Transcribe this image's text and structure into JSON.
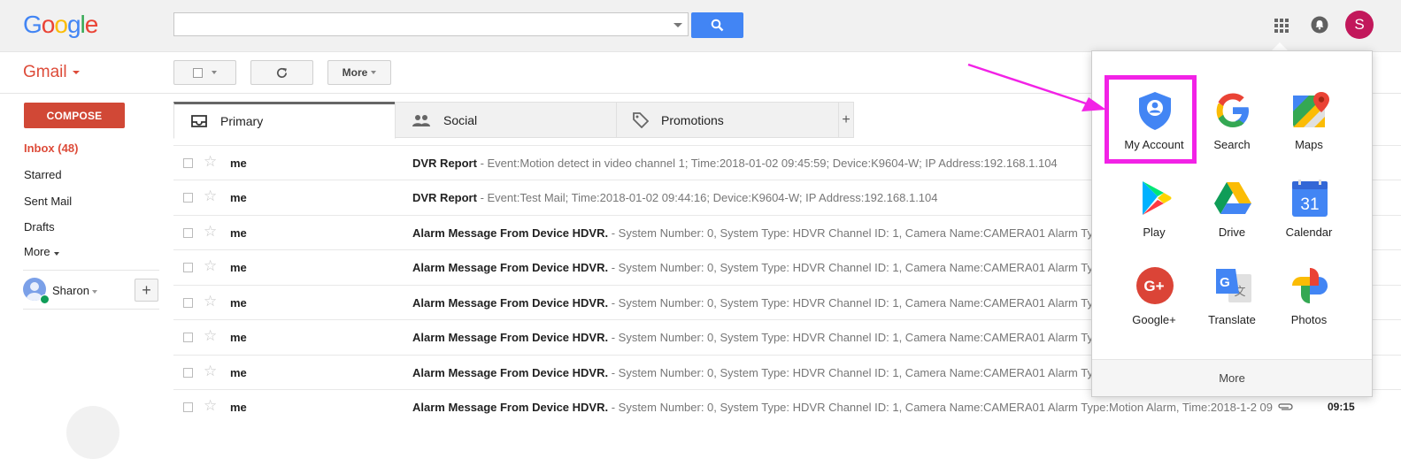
{
  "header": {
    "logo_letters": [
      {
        "char": "G",
        "color": "#4285f4"
      },
      {
        "char": "o",
        "color": "#ea4335"
      },
      {
        "char": "o",
        "color": "#fbbc05"
      },
      {
        "char": "g",
        "color": "#4285f4"
      },
      {
        "char": "l",
        "color": "#34a853"
      },
      {
        "char": "e",
        "color": "#ea4335"
      }
    ],
    "search_value": "",
    "search_placeholder": "",
    "avatar_letter": "S",
    "avatar_color": "#c2185b"
  },
  "toolbar": {
    "app_label": "Gmail",
    "more_label": "More"
  },
  "sidebar": {
    "compose_label": "COMPOSE",
    "items": [
      {
        "label": "Inbox (48)"
      },
      {
        "label": "Starred"
      },
      {
        "label": "Sent Mail"
      },
      {
        "label": "Drafts"
      },
      {
        "label": "More"
      }
    ],
    "user_name": "Sharon"
  },
  "tabs": [
    {
      "label": "Primary",
      "icon": "inbox-icon"
    },
    {
      "label": "Social",
      "icon": "people-icon"
    },
    {
      "label": "Promotions",
      "icon": "tag-icon"
    }
  ],
  "messages": [
    {
      "sender": "me",
      "subject": "DVR Report",
      "snippet": " - Event:Motion detect in video channel 1; Time:2018-01-02 09:45:59; Device:K9604-W; IP Address:192.168.1.104",
      "time": ""
    },
    {
      "sender": "me",
      "subject": "DVR Report",
      "snippet": " - Event:Test Mail; Time:2018-01-02 09:44:16; Device:K9604-W; IP Address:192.168.1.104",
      "time": ""
    },
    {
      "sender": "me",
      "subject": "Alarm Message From Device HDVR.",
      "snippet": " - System Number: 0, System Type: HDVR Channel ID: 1, Camera Name:CAMERA01 Alarm Ty",
      "time": ""
    },
    {
      "sender": "me",
      "subject": "Alarm Message From Device HDVR.",
      "snippet": " - System Number: 0, System Type: HDVR Channel ID: 1, Camera Name:CAMERA01 Alarm Ty",
      "time": ""
    },
    {
      "sender": "me",
      "subject": "Alarm Message From Device HDVR.",
      "snippet": " - System Number: 0, System Type: HDVR Channel ID: 1, Camera Name:CAMERA01 Alarm Ty",
      "time": ""
    },
    {
      "sender": "me",
      "subject": "Alarm Message From Device HDVR.",
      "snippet": " - System Number: 0, System Type: HDVR Channel ID: 1, Camera Name:CAMERA01 Alarm Ty",
      "time": ""
    },
    {
      "sender": "me",
      "subject": "Alarm Message From Device HDVR.",
      "snippet": " - System Number: 0, System Type: HDVR Channel ID: 1, Camera Name:CAMERA01 Alarm Ty",
      "time": ""
    },
    {
      "sender": "me",
      "subject": "Alarm Message From Device HDVR.",
      "snippet": " - System Number: 0, System Type: HDVR Channel ID: 1, Camera Name:CAMERA01 Alarm Type:Motion Alarm, Time:2018-1-2 09",
      "time": "09:15",
      "attachment": "paperclip-icon"
    }
  ],
  "apps_panel": {
    "apps": [
      {
        "label": "My Account",
        "icon": "my-account-icon"
      },
      {
        "label": "Search",
        "icon": "google-search-icon"
      },
      {
        "label": "Maps",
        "icon": "maps-icon"
      },
      {
        "label": "Play",
        "icon": "play-icon"
      },
      {
        "label": "Drive",
        "icon": "drive-icon"
      },
      {
        "label": "Calendar",
        "icon": "calendar-icon"
      },
      {
        "label": "Google+",
        "icon": "google-plus-icon"
      },
      {
        "label": "Translate",
        "icon": "translate-icon"
      },
      {
        "label": "Photos",
        "icon": "photos-icon"
      }
    ],
    "calendar_day": "31",
    "more_label": "More",
    "highlight_color": "#f222e6"
  }
}
